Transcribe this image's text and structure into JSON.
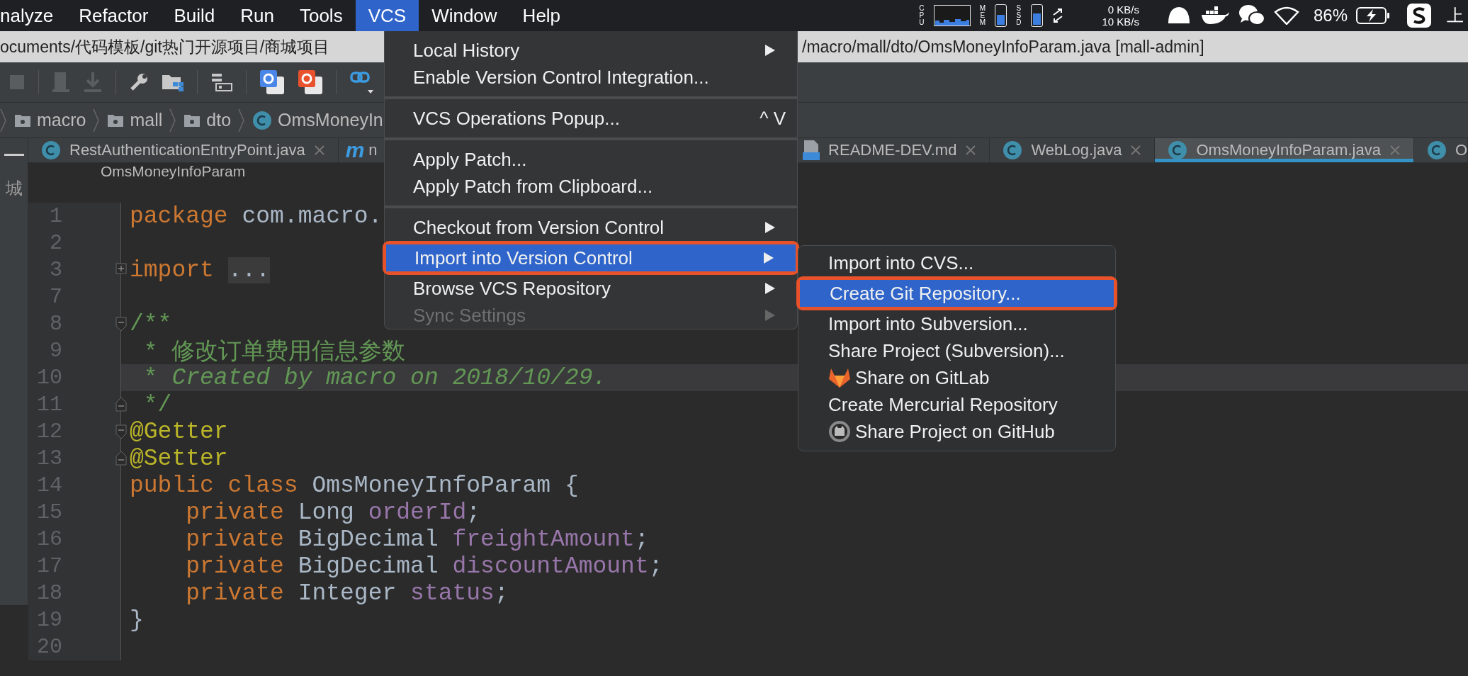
{
  "menu_bar": {
    "items": [
      {
        "label": "nalyze",
        "selected": false
      },
      {
        "label": "Refactor",
        "selected": false
      },
      {
        "label": "Build",
        "selected": false
      },
      {
        "label": "Run",
        "selected": false
      },
      {
        "label": "Tools",
        "selected": false
      },
      {
        "label": "VCS",
        "selected": true
      },
      {
        "label": "Window",
        "selected": false
      },
      {
        "label": "Help",
        "selected": false
      }
    ],
    "status": {
      "cpu_label": "CPU",
      "mem_label": "MEM",
      "ssd_label": "SSD",
      "mem": {
        "level": 0.55
      },
      "ssd": {
        "level": 0.6
      },
      "net_up": "0 KB/s",
      "net_down": "10 KB/s",
      "battery": "86%",
      "clock": "上"
    }
  },
  "path_bar": {
    "left": "ocuments/代码模板/git热门开源项目/商城项目",
    "right": "/macro/mall/dto/OmsMoneyInfoParam.java [mall-admin]"
  },
  "breadcrumbs": [
    {
      "label": "macro",
      "kind": "folder"
    },
    {
      "label": "mall",
      "kind": "folder"
    },
    {
      "label": "dto",
      "kind": "folder"
    },
    {
      "label": "OmsMoneyIn",
      "kind": "class"
    }
  ],
  "project_strip": {
    "label": "城"
  },
  "tabs": [
    {
      "label": "RestAuthenticationEntryPoint.java",
      "kind": "class",
      "selected": false,
      "closable": true
    },
    {
      "label": "n",
      "kind": "m",
      "icon_text": "m",
      "selected": false,
      "closable": false
    },
    {
      "label": "README-DEV.md",
      "kind": "md",
      "selected": false,
      "closable": true
    },
    {
      "label": "WebLog.java",
      "kind": "class",
      "selected": false,
      "closable": true
    },
    {
      "label": "OmsMoneyInfoParam.java",
      "kind": "class",
      "selected": true,
      "closable": true
    },
    {
      "label": "O",
      "kind": "class",
      "selected": false,
      "closable": false
    }
  ],
  "editor_header": "OmsMoneyInfoParam",
  "code_lines": [
    {
      "number": "1",
      "kind": "plain",
      "current": false,
      "tokens": [
        {
          "text": "package",
          "kind": "keyword"
        },
        {
          "text": " com.macro.",
          "kind": "plain"
        }
      ]
    },
    {
      "number": "2",
      "kind": "plain",
      "current": false
    },
    {
      "number": "3",
      "kind": "fold-expand",
      "current": false,
      "tokens": [
        {
          "text": "import",
          "kind": "keyword"
        },
        {
          "text": "...",
          "kind": "folded"
        }
      ]
    },
    {
      "number": "7",
      "kind": "plain",
      "current": false
    },
    {
      "number": "8",
      "kind": "fold-start",
      "current": false,
      "tokens": [
        {
          "text": "/**",
          "kind": "comment"
        }
      ]
    },
    {
      "number": "9",
      "kind": "plain",
      "current": false,
      "tokens": [
        {
          "text": " * 修改订单费用信息参数",
          "kind": "comment"
        }
      ]
    },
    {
      "number": "10",
      "kind": "plain",
      "current": true,
      "tokens": [
        {
          "text": " * ",
          "kind": "comment"
        },
        {
          "text": "Created by macro on 2018/10/29.",
          "kind": "comment-italic"
        }
      ]
    },
    {
      "number": "11",
      "kind": "fold-end",
      "current": false,
      "tokens": [
        {
          "text": " */",
          "kind": "comment"
        }
      ]
    },
    {
      "number": "12",
      "kind": "fold-start",
      "current": false,
      "tokens": [
        {
          "text": "@Getter",
          "kind": "annotation"
        }
      ]
    },
    {
      "number": "13",
      "kind": "fold-end",
      "current": false,
      "tokens": [
        {
          "text": "@Setter",
          "kind": "annotation"
        }
      ]
    },
    {
      "number": "14",
      "kind": "plain",
      "current": false,
      "tokens": [
        {
          "text": "public class",
          "kind": "keyword"
        },
        {
          "text": " OmsMoneyInfoParam {",
          "kind": "plain"
        }
      ]
    },
    {
      "number": "15",
      "kind": "plain",
      "current": false,
      "tokens": [
        {
          "text": "    private",
          "kind": "keyword"
        },
        {
          "text": " Long ",
          "kind": "plain"
        },
        {
          "text": "orderId",
          "kind": "field"
        },
        {
          "text": ";",
          "kind": "plain"
        }
      ]
    },
    {
      "number": "16",
      "kind": "plain",
      "current": false,
      "tokens": [
        {
          "text": "    private",
          "kind": "keyword"
        },
        {
          "text": " BigDecimal ",
          "kind": "plain"
        },
        {
          "text": "freightAmount",
          "kind": "field"
        },
        {
          "text": ";",
          "kind": "plain"
        }
      ]
    },
    {
      "number": "17",
      "kind": "plain",
      "current": false,
      "tokens": [
        {
          "text": "    private",
          "kind": "keyword"
        },
        {
          "text": " BigDecimal ",
          "kind": "plain"
        },
        {
          "text": "discountAmount",
          "kind": "field"
        },
        {
          "text": ";",
          "kind": "plain"
        }
      ]
    },
    {
      "number": "18",
      "kind": "plain",
      "current": false,
      "tokens": [
        {
          "text": "    private",
          "kind": "keyword"
        },
        {
          "text": " Integer ",
          "kind": "plain"
        },
        {
          "text": "status",
          "kind": "field"
        },
        {
          "text": ";",
          "kind": "plain"
        }
      ]
    },
    {
      "number": "19",
      "kind": "plain",
      "current": false,
      "tokens": [
        {
          "text": "}",
          "kind": "plain"
        }
      ]
    },
    {
      "number": "20",
      "kind": "plain",
      "current": false
    }
  ],
  "vcs_menu": {
    "groups": [
      [
        {
          "label": "Local History",
          "submenu": true,
          "disabled": false,
          "selected": false,
          "outlined": false
        },
        {
          "label": "Enable Version Control Integration...",
          "submenu": false,
          "disabled": false,
          "selected": false,
          "outlined": false
        }
      ],
      [
        {
          "label": "VCS Operations Popup...",
          "shortcut": "^ V",
          "submenu": false,
          "disabled": false,
          "selected": false,
          "outlined": false
        }
      ],
      [
        {
          "label": "Apply Patch...",
          "submenu": false,
          "disabled": false,
          "selected": false,
          "outlined": false
        },
        {
          "label": "Apply Patch from Clipboard...",
          "submenu": false,
          "disabled": false,
          "selected": false,
          "outlined": false
        }
      ],
      [
        {
          "label": "Checkout from Version Control",
          "submenu": true,
          "disabled": false,
          "selected": false,
          "outlined": false
        },
        {
          "label": "Import into Version Control",
          "submenu": true,
          "disabled": false,
          "selected": true,
          "outlined": true
        },
        {
          "label": "Browse VCS Repository",
          "submenu": true,
          "disabled": false,
          "selected": false,
          "outlined": false
        },
        {
          "label": "Sync Settings",
          "submenu": true,
          "disabled": true,
          "selected": false,
          "outlined": false
        }
      ]
    ]
  },
  "import_submenu": {
    "items": [
      {
        "label": "Import into CVS...",
        "kind": "plain",
        "selected": false,
        "outlined": false
      },
      {
        "label": "Create Git Repository...",
        "kind": "plain",
        "selected": true,
        "outlined": true
      },
      {
        "label": "Import into Subversion...",
        "kind": "plain",
        "selected": false,
        "outlined": false
      },
      {
        "label": "Share Project (Subversion)...",
        "kind": "plain",
        "selected": false,
        "outlined": false
      },
      {
        "label": "Share on GitLab",
        "kind": "gitlab",
        "selected": false,
        "outlined": false
      },
      {
        "label": "Create Mercurial Repository",
        "kind": "plain",
        "selected": false,
        "outlined": false
      },
      {
        "label": "Share Project on GitHub",
        "kind": "github",
        "selected": false,
        "outlined": false
      }
    ]
  }
}
